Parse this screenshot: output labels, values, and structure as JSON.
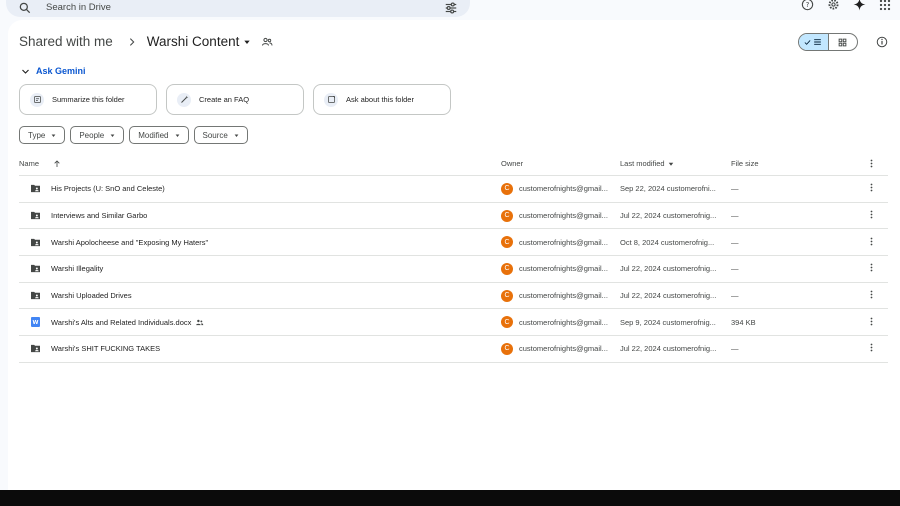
{
  "search": {
    "placeholder": "Search in Drive"
  },
  "breadcrumb": {
    "parent": "Shared with me",
    "current": "Warshi Content"
  },
  "gemini": {
    "label": "Ask Gemini"
  },
  "suggestions": [
    {
      "label": "Summarize this folder",
      "icon": "summarize-icon"
    },
    {
      "label": "Create an FAQ",
      "icon": "magic-pen-icon"
    },
    {
      "label": "Ask about this folder",
      "icon": "ask-icon"
    }
  ],
  "filters": [
    {
      "label": "Type"
    },
    {
      "label": "People"
    },
    {
      "label": "Modified"
    },
    {
      "label": "Source"
    }
  ],
  "columns": {
    "name": "Name",
    "owner": "Owner",
    "modified": "Last modified",
    "size": "File size"
  },
  "files": [
    {
      "name": "His Projects (U: SnO and Celeste)",
      "type": "folder",
      "owner": "customerofnights@gmail...",
      "avatar": "C",
      "modified": "Sep 22, 2024 customerofni...",
      "size": "—",
      "shared": false
    },
    {
      "name": "Interviews and Similar Garbo",
      "type": "folder",
      "owner": "customerofnights@gmail...",
      "avatar": "C",
      "modified": "Jul 22, 2024 customerofnig...",
      "size": "—",
      "shared": false
    },
    {
      "name": "Warshi Apolocheese and \"Exposing My Haters\"",
      "type": "folder",
      "owner": "customerofnights@gmail...",
      "avatar": "C",
      "modified": "Oct 8, 2024 customerofnig...",
      "size": "—",
      "shared": false
    },
    {
      "name": "Warshi Illegality",
      "type": "folder",
      "owner": "customerofnights@gmail...",
      "avatar": "C",
      "modified": "Jul 22, 2024 customerofnig...",
      "size": "—",
      "shared": false
    },
    {
      "name": "Warshi Uploaded Drives",
      "type": "folder",
      "owner": "customerofnights@gmail...",
      "avatar": "C",
      "modified": "Jul 22, 2024 customerofnig...",
      "size": "—",
      "shared": false
    },
    {
      "name": "Warshi's Alts and Related Individuals.docx",
      "type": "doc",
      "owner": "customerofnights@gmail...",
      "avatar": "C",
      "modified": "Sep 9, 2024 customerofnig...",
      "size": "394 KB",
      "shared": true
    },
    {
      "name": "Warshi's SHIT FUCKING TAKES",
      "type": "folder",
      "owner": "customerofnights@gmail...",
      "avatar": "C",
      "modified": "Jul 22, 2024 customerofnig...",
      "size": "—",
      "shared": false
    }
  ],
  "colors": {
    "accent": "#0b57d0",
    "toggle_active": "#c2e7ff",
    "avatar": "#e8710a",
    "doc_blue": "#4285f4"
  }
}
